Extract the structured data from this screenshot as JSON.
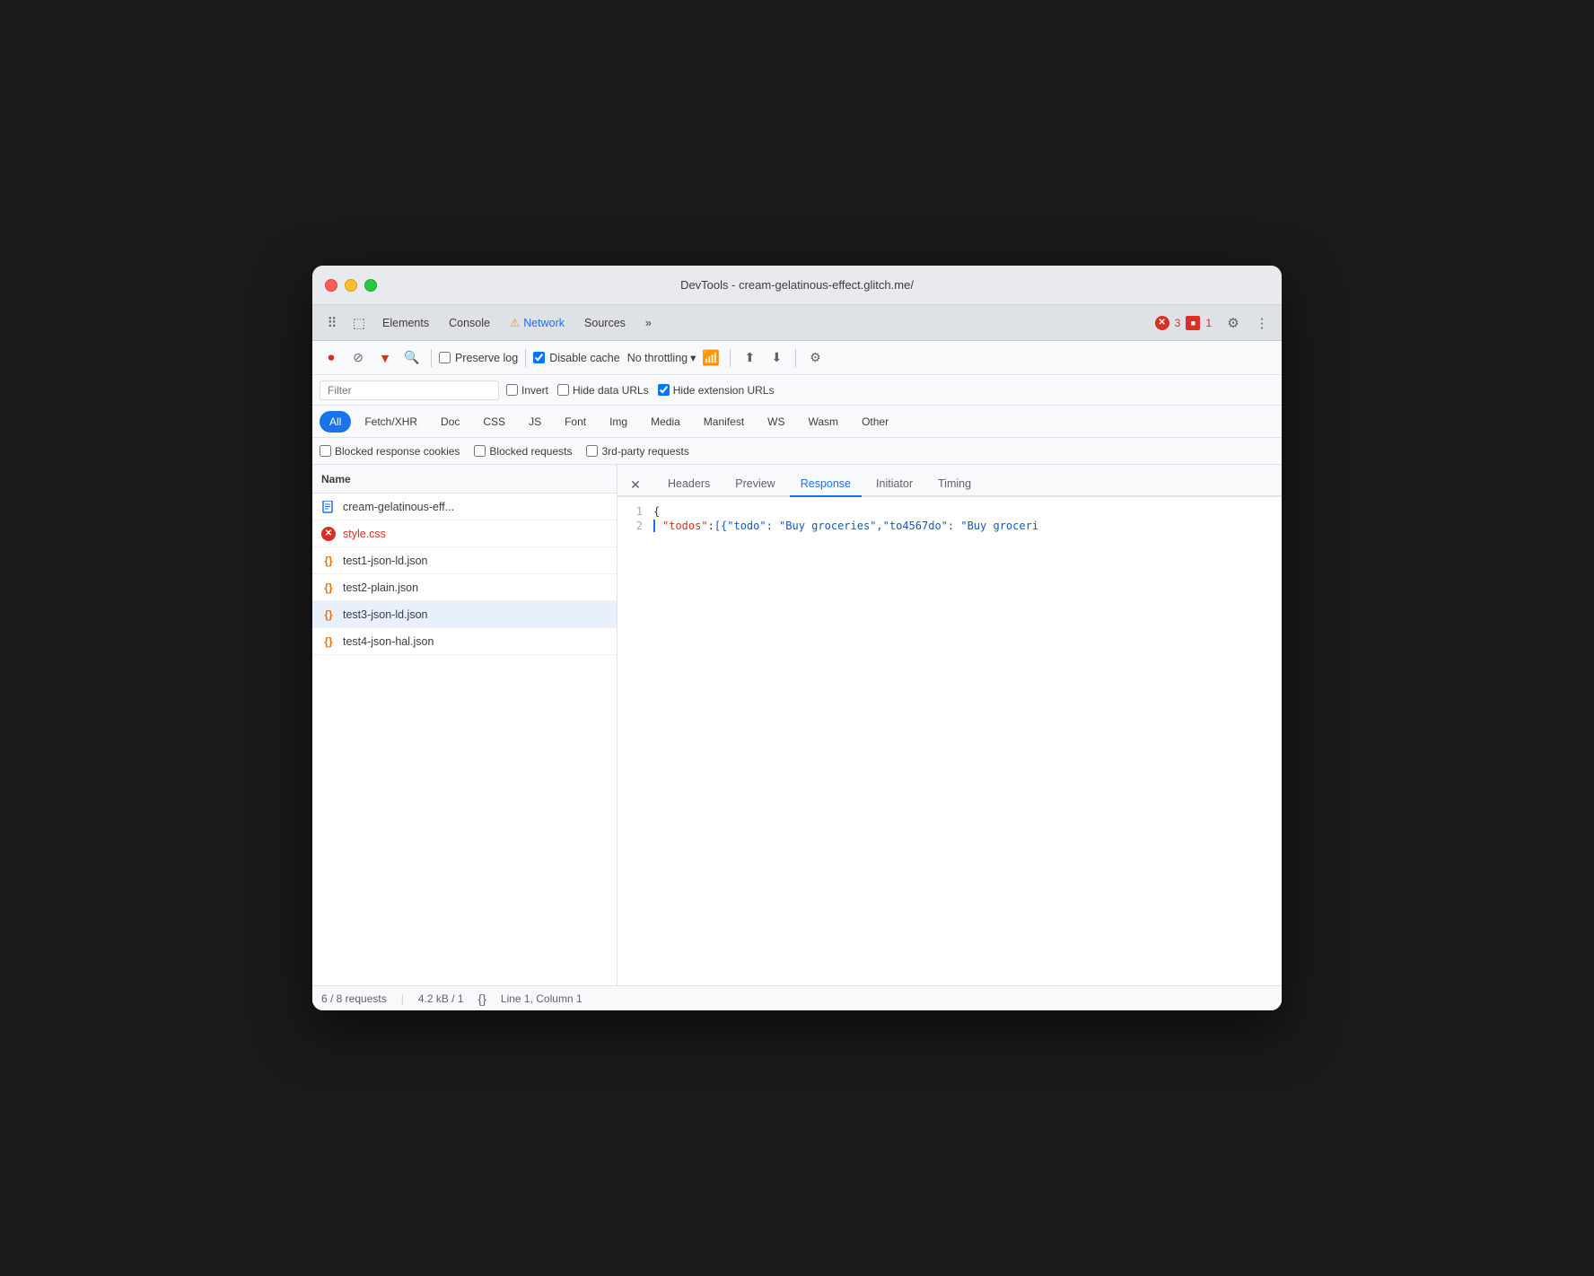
{
  "window": {
    "title": "DevTools - cream-gelatinous-effect.glitch.me/"
  },
  "tabs": {
    "inspector_icon": "⠿",
    "responsive_icon": "⬜",
    "elements": "Elements",
    "console": "Console",
    "network": "Network",
    "sources": "Sources",
    "more": "»",
    "error_count": "3",
    "warn_count": "1"
  },
  "toolbar": {
    "record_title": "Stop recording network log",
    "clear_title": "Clear",
    "filter_title": "Filter",
    "search_title": "Search",
    "preserve_log": "Preserve log",
    "disable_cache": "Disable cache",
    "throttling": "No throttling",
    "online_icon": "📶",
    "import_title": "Import HAR file",
    "export_title": "Export HAR",
    "settings_title": "Network settings"
  },
  "filter": {
    "placeholder": "Filter",
    "invert": "Invert",
    "hide_data": "Hide data URLs",
    "hide_extension": "Hide extension URLs"
  },
  "type_filters": [
    {
      "id": "all",
      "label": "All",
      "active": true
    },
    {
      "id": "fetch_xhr",
      "label": "Fetch/XHR",
      "active": false
    },
    {
      "id": "doc",
      "label": "Doc",
      "active": false
    },
    {
      "id": "css",
      "label": "CSS",
      "active": false
    },
    {
      "id": "js",
      "label": "JS",
      "active": false
    },
    {
      "id": "font",
      "label": "Font",
      "active": false
    },
    {
      "id": "img",
      "label": "Img",
      "active": false
    },
    {
      "id": "media",
      "label": "Media",
      "active": false
    },
    {
      "id": "manifest",
      "label": "Manifest",
      "active": false
    },
    {
      "id": "ws",
      "label": "WS",
      "active": false
    },
    {
      "id": "wasm",
      "label": "Wasm",
      "active": false
    },
    {
      "id": "other",
      "label": "Other",
      "active": false
    }
  ],
  "extra_filters": {
    "blocked_cookies": "Blocked response cookies",
    "blocked_requests": "Blocked requests",
    "third_party": "3rd-party requests"
  },
  "file_list": {
    "header": "Name",
    "files": [
      {
        "id": "cream",
        "name": "cream-gelatinous-eff...",
        "type": "doc",
        "selected": false
      },
      {
        "id": "style_css",
        "name": "style.css",
        "type": "error",
        "selected": false
      },
      {
        "id": "test1",
        "name": "test1-json-ld.json",
        "type": "json",
        "selected": false
      },
      {
        "id": "test2",
        "name": "test2-plain.json",
        "type": "json",
        "selected": false
      },
      {
        "id": "test3",
        "name": "test3-json-ld.json",
        "type": "json",
        "selected": true
      },
      {
        "id": "test4",
        "name": "test4-json-hal.json",
        "type": "json",
        "selected": false
      }
    ]
  },
  "response_panel": {
    "tabs": [
      "Headers",
      "Preview",
      "Response",
      "Initiator",
      "Timing"
    ],
    "active_tab": "Response",
    "code": {
      "line1": "{",
      "line2_key": "\"todos\"",
      "line2_colon": ": ",
      "line2_value": "[{\"todo\": \"Buy groceries\",\"to4567do\": \"Buy groceri"
    }
  },
  "status_bar": {
    "requests": "6 / 8 requests",
    "size": "4.2 kB / 1",
    "format_icon": "{}",
    "position": "Line 1, Column 1"
  }
}
